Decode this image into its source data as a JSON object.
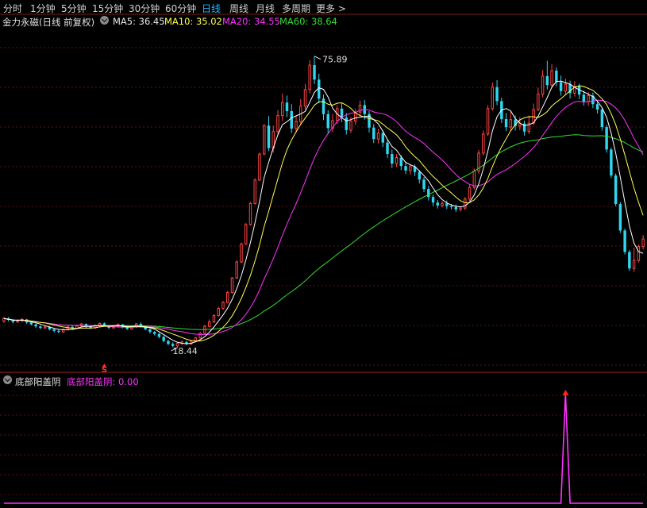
{
  "tabs": [
    "分时",
    "1分钟",
    "5分钟",
    "15分钟",
    "30分钟",
    "60分钟",
    "日线",
    "周线",
    "月线",
    "多周期",
    "更多 >"
  ],
  "active_tab": "日线",
  "main_legend": {
    "title": "金力永磁(日线 前复权)",
    "ma5": "MA5: 36.45",
    "ma10": "MA10: 35.02",
    "ma20": "MA20: 34.55",
    "ma60": "MA60: 38.64"
  },
  "sub_legend": {
    "title": "底部阳盖阴",
    "value": "底部阳盖阴: 0.00"
  },
  "annotations": {
    "high": "75.89",
    "low": "18.44",
    "signal": "S"
  },
  "colors": {
    "up": "#ff4545",
    "down": "#2fd6f0",
    "ma5": "#ffffff",
    "ma10": "#ffff4d",
    "ma20": "#ff33ff",
    "ma60": "#33dd33",
    "indicator": "#ff33ff",
    "grid": "#5a1515"
  },
  "chart_data": [
    {
      "type": "candlestick",
      "title": "金力永磁(日线 前复权)",
      "ylim": [
        14,
        82
      ],
      "annotations": [
        {
          "label": "75.89",
          "kind": "high"
        },
        {
          "label": "18.44",
          "kind": "low"
        }
      ],
      "series_names": [
        "MA5",
        "MA10",
        "MA20",
        "MA60"
      ],
      "ma5_last": 36.45,
      "ma10_last": 35.02,
      "ma20_last": 34.55,
      "ma60_last": 38.64,
      "candles": [
        [
          23.8,
          24.3,
          24.6,
          23.4
        ],
        [
          24.3,
          24.0,
          24.6,
          23.7
        ],
        [
          24.0,
          23.6,
          24.2,
          23.3
        ],
        [
          23.6,
          23.8,
          24.2,
          23.4
        ],
        [
          23.8,
          24.1,
          24.4,
          23.6
        ],
        [
          24.1,
          23.5,
          24.2,
          23.2
        ],
        [
          23.5,
          23.1,
          23.7,
          22.9
        ],
        [
          23.1,
          22.7,
          23.3,
          22.4
        ],
        [
          22.7,
          22.4,
          22.9,
          22.1
        ],
        [
          22.4,
          22.6,
          22.9,
          22.2
        ],
        [
          22.6,
          22.1,
          22.8,
          21.9
        ],
        [
          22.1,
          21.8,
          22.3,
          21.5
        ],
        [
          21.8,
          21.6,
          22.1,
          21.3
        ],
        [
          21.6,
          22.1,
          22.3,
          21.4
        ],
        [
          22.1,
          22.6,
          22.8,
          21.9
        ],
        [
          22.6,
          22.3,
          22.9,
          22.1
        ],
        [
          22.3,
          22.8,
          23.0,
          22.2
        ],
        [
          22.8,
          23.2,
          23.4,
          22.6
        ],
        [
          23.2,
          22.7,
          23.3,
          22.4
        ],
        [
          22.7,
          22.4,
          22.9,
          22.2
        ],
        [
          22.4,
          22.9,
          23.1,
          22.2
        ],
        [
          22.9,
          23.3,
          23.5,
          22.7
        ],
        [
          23.3,
          22.9,
          23.5,
          22.7
        ],
        [
          22.9,
          22.4,
          23.0,
          22.2
        ],
        [
          22.4,
          22.7,
          22.9,
          22.2
        ],
        [
          22.7,
          23.1,
          23.3,
          22.5
        ],
        [
          23.1,
          22.5,
          23.2,
          22.3
        ],
        [
          22.5,
          22.2,
          22.7,
          22.0
        ],
        [
          22.2,
          22.6,
          22.8,
          22.0
        ],
        [
          22.6,
          23.2,
          23.4,
          22.4
        ],
        [
          23.2,
          22.7,
          23.5,
          22.5
        ],
        [
          22.7,
          22.1,
          22.9,
          21.9
        ],
        [
          22.1,
          21.6,
          22.3,
          21.3
        ],
        [
          21.6,
          21.2,
          21.8,
          20.9
        ],
        [
          21.2,
          20.6,
          21.4,
          20.3
        ],
        [
          20.6,
          19.8,
          20.8,
          19.5
        ],
        [
          19.8,
          19.2,
          20.0,
          18.9
        ],
        [
          19.2,
          18.8,
          19.5,
          18.5
        ],
        [
          18.8,
          19.3,
          19.5,
          18.44
        ],
        [
          19.3,
          19.6,
          19.9,
          19.0
        ],
        [
          19.6,
          19.2,
          19.8,
          18.9
        ],
        [
          19.2,
          19.7,
          20.0,
          19.0
        ],
        [
          19.7,
          20.4,
          20.6,
          19.5
        ],
        [
          20.4,
          21.3,
          21.6,
          20.2
        ],
        [
          21.3,
          22.7,
          23.0,
          21.1
        ],
        [
          22.7,
          23.6,
          24.1,
          22.5
        ],
        [
          23.6,
          24.9,
          25.1,
          23.4
        ],
        [
          24.9,
          26.3,
          26.6,
          24.7
        ],
        [
          26.3,
          27.5,
          27.8,
          26.0
        ],
        [
          27.5,
          29.5,
          29.8,
          27.3
        ],
        [
          29.5,
          32.4,
          32.6,
          29.3
        ],
        [
          32.4,
          35.6,
          35.9,
          32.2
        ],
        [
          35.6,
          39.2,
          39.5,
          35.4
        ],
        [
          39.2,
          43.1,
          43.4,
          39.0
        ],
        [
          43.1,
          47.3,
          47.6,
          42.9
        ],
        [
          47.3,
          52.0,
          52.3,
          47.1
        ],
        [
          52.0,
          57.2,
          57.5,
          51.8
        ],
        [
          57.2,
          62.9,
          63.2,
          57.0
        ],
        [
          62.9,
          58.4,
          64.8,
          57.8
        ],
        [
          58.4,
          61.7,
          62.9,
          57.5
        ],
        [
          61.7,
          64.9,
          66.0,
          61.0
        ],
        [
          64.9,
          67.5,
          69.3,
          63.8
        ],
        [
          67.5,
          65.8,
          68.9,
          64.6
        ],
        [
          65.8,
          62.3,
          67.2,
          61.4
        ],
        [
          62.3,
          63.7,
          64.8,
          61.5
        ],
        [
          63.7,
          66.8,
          68.2,
          63.0
        ],
        [
          66.8,
          70.1,
          71.2,
          66.0
        ],
        [
          70.1,
          75.0,
          76.0,
          69.3
        ],
        [
          75.0,
          72.1,
          76.8,
          71.2
        ],
        [
          72.1,
          68.3,
          73.3,
          67.4
        ],
        [
          68.3,
          65.2,
          69.1,
          64.0
        ],
        [
          65.2,
          62.4,
          66.0,
          61.2
        ],
        [
          62.4,
          63.9,
          65.2,
          61.6
        ],
        [
          63.9,
          66.3,
          67.0,
          63.2
        ],
        [
          66.3,
          64.5,
          67.4,
          63.6
        ],
        [
          64.5,
          62.0,
          65.4,
          61.1
        ],
        [
          62.0,
          63.8,
          64.6,
          61.4
        ],
        [
          63.8,
          65.6,
          66.3,
          63.0
        ],
        [
          65.6,
          67.0,
          67.9,
          64.8
        ],
        [
          67.0,
          65.2,
          68.0,
          64.1
        ],
        [
          65.2,
          62.5,
          65.8,
          61.5
        ],
        [
          62.5,
          60.2,
          63.2,
          59.4
        ],
        [
          60.2,
          61.4,
          62.3,
          59.3
        ],
        [
          61.4,
          59.5,
          62.0,
          58.6
        ],
        [
          59.5,
          57.2,
          60.1,
          56.4
        ],
        [
          57.2,
          55.3,
          58.1,
          54.4
        ],
        [
          55.3,
          56.5,
          57.2,
          54.6
        ],
        [
          56.5,
          54.8,
          57.0,
          54.0
        ],
        [
          54.8,
          53.9,
          55.6,
          53.2
        ],
        [
          53.9,
          54.7,
          55.3,
          53.1
        ],
        [
          54.7,
          53.6,
          55.1,
          52.8
        ],
        [
          53.6,
          52.1,
          54.0,
          51.3
        ],
        [
          52.1,
          50.2,
          52.6,
          49.6
        ],
        [
          50.2,
          48.6,
          50.8,
          47.9
        ],
        [
          48.6,
          47.5,
          49.1,
          46.8
        ],
        [
          47.5,
          46.9,
          48.0,
          46.3
        ],
        [
          46.9,
          47.3,
          47.8,
          46.5
        ],
        [
          47.3,
          46.8,
          47.9,
          46.2
        ],
        [
          46.8,
          46.6,
          47.2,
          46.1
        ],
        [
          46.6,
          46.1,
          47.1,
          45.6
        ],
        [
          46.1,
          46.4,
          46.8,
          45.7
        ],
        [
          46.4,
          48.2,
          48.6,
          46.0
        ],
        [
          48.2,
          50.5,
          51.1,
          47.8
        ],
        [
          50.5,
          53.8,
          54.3,
          50.1
        ],
        [
          53.8,
          57.4,
          58.0,
          53.2
        ],
        [
          57.4,
          61.2,
          61.9,
          56.9
        ],
        [
          61.2,
          66.3,
          67.0,
          60.8
        ],
        [
          66.3,
          70.6,
          71.5,
          65.9
        ],
        [
          70.6,
          67.8,
          72.0,
          67.0
        ],
        [
          67.8,
          64.2,
          68.5,
          63.4
        ],
        [
          64.2,
          62.6,
          65.4,
          61.8
        ],
        [
          62.6,
          64.1,
          65.8,
          61.9
        ],
        [
          64.1,
          62.8,
          64.9,
          61.9
        ],
        [
          62.8,
          63.3,
          64.6,
          62.0
        ],
        [
          63.3,
          61.7,
          63.9,
          60.9
        ],
        [
          61.7,
          63.4,
          64.9,
          61.2
        ],
        [
          63.4,
          66.1,
          67.3,
          63.0
        ],
        [
          66.1,
          69.2,
          70.5,
          65.8
        ],
        [
          69.2,
          72.8,
          74.0,
          68.6
        ],
        [
          72.8,
          71.0,
          75.89,
          70.1
        ],
        [
          71.0,
          73.9,
          75.2,
          70.4
        ],
        [
          73.9,
          71.6,
          74.6,
          70.8
        ],
        [
          71.6,
          69.8,
          72.9,
          68.9
        ],
        [
          69.8,
          71.2,
          72.3,
          69.0
        ],
        [
          71.2,
          69.4,
          71.9,
          68.3
        ],
        [
          69.4,
          70.8,
          71.8,
          68.7
        ],
        [
          70.8,
          69.1,
          71.3,
          68.2
        ],
        [
          69.1,
          67.7,
          69.9,
          66.9
        ],
        [
          67.7,
          68.9,
          69.6,
          66.8
        ],
        [
          68.9,
          67.2,
          69.5,
          66.4
        ],
        [
          67.2,
          66.1,
          67.9,
          65.3
        ],
        [
          66.1,
          62.6,
          66.5,
          61.9
        ],
        [
          62.6,
          58.1,
          63.0,
          57.5
        ],
        [
          58.1,
          52.9,
          58.5,
          52.4
        ],
        [
          52.9,
          47.2,
          53.3,
          46.8
        ],
        [
          47.2,
          41.9,
          47.6,
          41.4
        ],
        [
          41.9,
          37.6,
          42.3,
          37.1
        ],
        [
          37.6,
          34.3,
          38.0,
          33.8
        ],
        [
          34.3,
          35.9,
          38.5,
          33.6
        ],
        [
          35.9,
          38.7,
          39.1,
          35.5
        ],
        [
          38.7,
          40.2,
          41.0,
          38.1
        ]
      ]
    },
    {
      "type": "line",
      "title": "底部阳盖阴",
      "series": [
        {
          "name": "底部阳盖阴",
          "last": 0.0,
          "spike_at_index": 123,
          "spike_value": 1
        }
      ]
    }
  ]
}
